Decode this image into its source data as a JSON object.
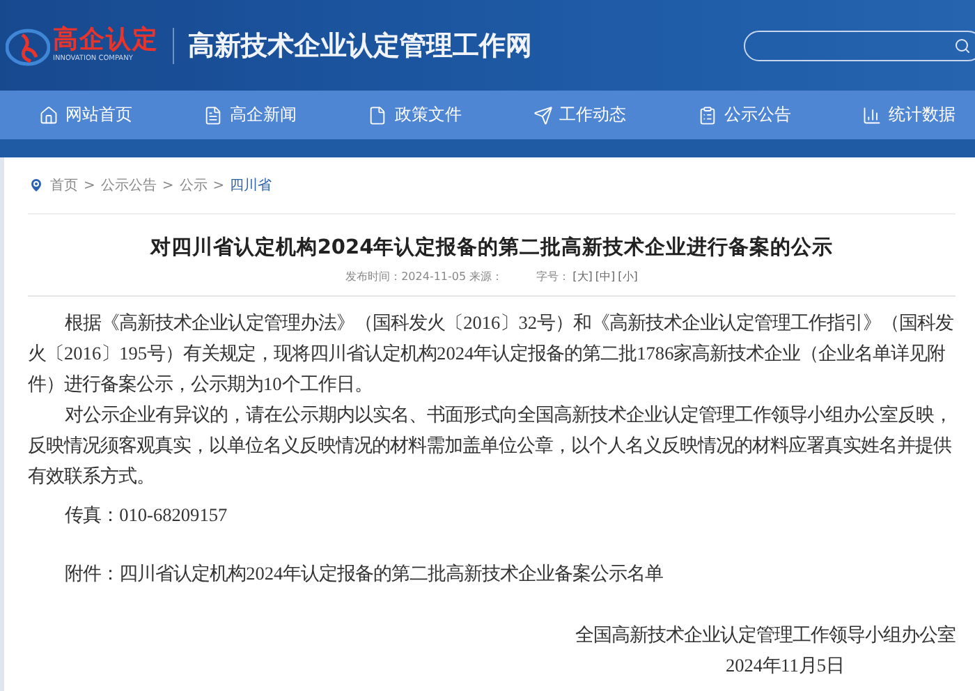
{
  "header": {
    "logo_name": "高企认定",
    "logo_subtitle": "INNOVATION COMPANY",
    "site_title": "高新技术企业认定管理工作网"
  },
  "nav": [
    {
      "label": "网站首页",
      "kind": "home"
    },
    {
      "label": "高企新闻",
      "kind": "news"
    },
    {
      "label": "政策文件",
      "kind": "file"
    },
    {
      "label": "工作动态",
      "kind": "send"
    },
    {
      "label": "公示公告",
      "kind": "board"
    },
    {
      "label": "统计数据",
      "kind": "chart"
    }
  ],
  "breadcrumb": [
    {
      "label": "首页",
      "selected": false
    },
    {
      "label": "公示公告",
      "selected": false
    },
    {
      "label": "公示",
      "selected": false
    },
    {
      "label": "四川省",
      "selected": true
    }
  ],
  "breadcrumb_separator": ">",
  "article": {
    "title": "对四川省认定机构2024年认定报备的第二批高新技术企业进行备案的公示",
    "published": "发布时间：2024-11-05 来源：",
    "font_size_label": "字号：",
    "font_sizes": [
      "[大]",
      "[中]",
      "[小]"
    ],
    "paragraphs": [
      "根据《高新技术企业认定管理办法》（国科发火〔2016〕32号）和《高新技术企业认定管理工作指引》（国科发火〔2016〕195号）有关规定，现将四川省认定机构2024年认定报备的第二批1786家高新技术企业（企业名单详见附件）进行备案公示，公示期为10个工作日。",
      "对公示企业有异议的，请在公示期内以实名、书面形式向全国高新技术企业认定管理工作领导小组办公室反映，反映情况须客观真实，以单位名义反映情况的材料需加盖单位公章，以个人名义反映情况的材料应署真实姓名并提供有效联系方式。",
      "传真：010-68209157"
    ],
    "attachment": "附件：四川省认定机构2024年认定报备的第二批高新技术企业备案公示名单",
    "signature": "全国高新技术企业认定管理工作领导小组办公室",
    "date": "2024年11月5日"
  }
}
